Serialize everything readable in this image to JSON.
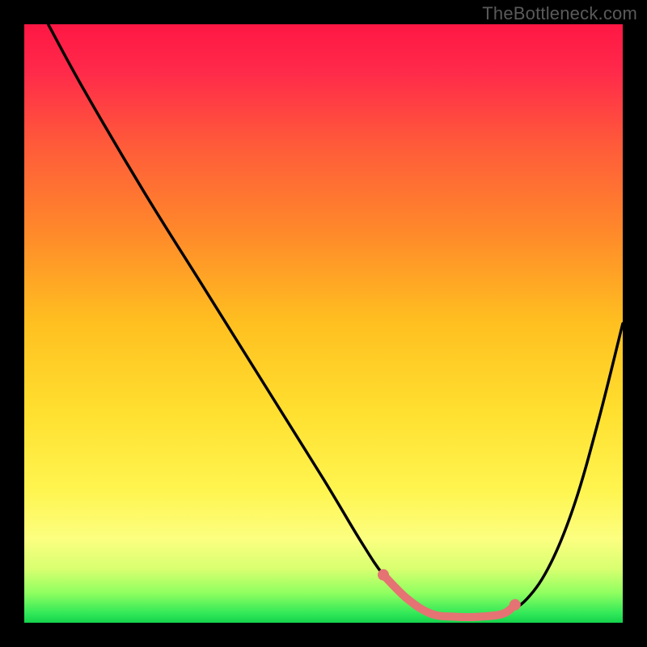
{
  "watermark": "TheBottleneck.com",
  "chart_data": {
    "type": "line",
    "title": "",
    "xlabel": "",
    "ylabel": "",
    "xlim": [
      0,
      100
    ],
    "ylim": [
      0,
      100
    ],
    "background_gradient_stops": [
      {
        "offset": 0.0,
        "color": "#ff1744"
      },
      {
        "offset": 0.08,
        "color": "#ff2a4a"
      },
      {
        "offset": 0.2,
        "color": "#ff5a3a"
      },
      {
        "offset": 0.35,
        "color": "#ff8a2a"
      },
      {
        "offset": 0.5,
        "color": "#ffc020"
      },
      {
        "offset": 0.65,
        "color": "#ffe030"
      },
      {
        "offset": 0.78,
        "color": "#fff550"
      },
      {
        "offset": 0.86,
        "color": "#fcff80"
      },
      {
        "offset": 0.91,
        "color": "#d8ff70"
      },
      {
        "offset": 0.95,
        "color": "#90ff60"
      },
      {
        "offset": 0.985,
        "color": "#30e858"
      },
      {
        "offset": 1.0,
        "color": "#14d24c"
      }
    ],
    "series": [
      {
        "name": "bottleneck-curve",
        "x": [
          4,
          10,
          20,
          30,
          40,
          50,
          56,
          60,
          64,
          68,
          72,
          76,
          80,
          84,
          88,
          92,
          96,
          100
        ],
        "y": [
          100,
          89,
          72,
          56,
          40,
          24,
          14,
          8,
          4,
          1.5,
          1,
          1,
          1.5,
          4,
          10,
          20,
          34,
          50
        ]
      }
    ],
    "highlight_segment": {
      "name": "optimal-range",
      "color": "#e57373",
      "x": [
        60,
        64,
        68,
        72,
        76,
        80,
        82
      ],
      "y": [
        8,
        4,
        1.5,
        1,
        1,
        1.5,
        3
      ],
      "endpoints": [
        {
          "x": 60,
          "y": 8
        },
        {
          "x": 82,
          "y": 3
        }
      ]
    }
  }
}
